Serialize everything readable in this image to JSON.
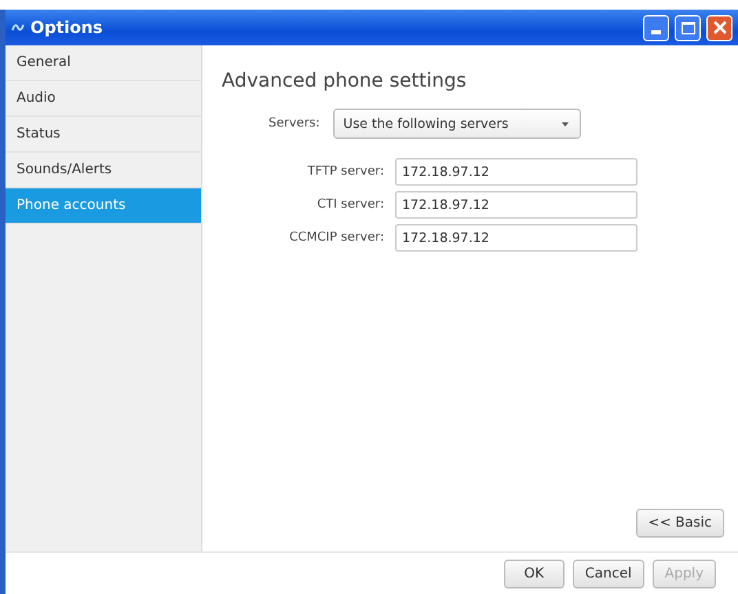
{
  "window": {
    "title": "Options"
  },
  "sidebar": {
    "items": [
      {
        "label": "General",
        "selected": false
      },
      {
        "label": "Audio",
        "selected": false
      },
      {
        "label": "Status",
        "selected": false
      },
      {
        "label": "Sounds/Alerts",
        "selected": false
      },
      {
        "label": "Phone accounts",
        "selected": true
      }
    ]
  },
  "content": {
    "heading": "Advanced phone settings",
    "servers": {
      "label": "Servers:",
      "value": "Use the following servers"
    },
    "fields": [
      {
        "label": "TFTP server:",
        "value": "172.18.97.12"
      },
      {
        "label": "CTI server:",
        "value": "172.18.97.12"
      },
      {
        "label": "CCMCIP server:",
        "value": "172.18.97.12"
      }
    ],
    "basic_button": "<< Basic"
  },
  "buttons": [
    {
      "label": "OK",
      "disabled": false
    },
    {
      "label": "Cancel",
      "disabled": false
    },
    {
      "label": "Apply",
      "disabled": true
    }
  ]
}
